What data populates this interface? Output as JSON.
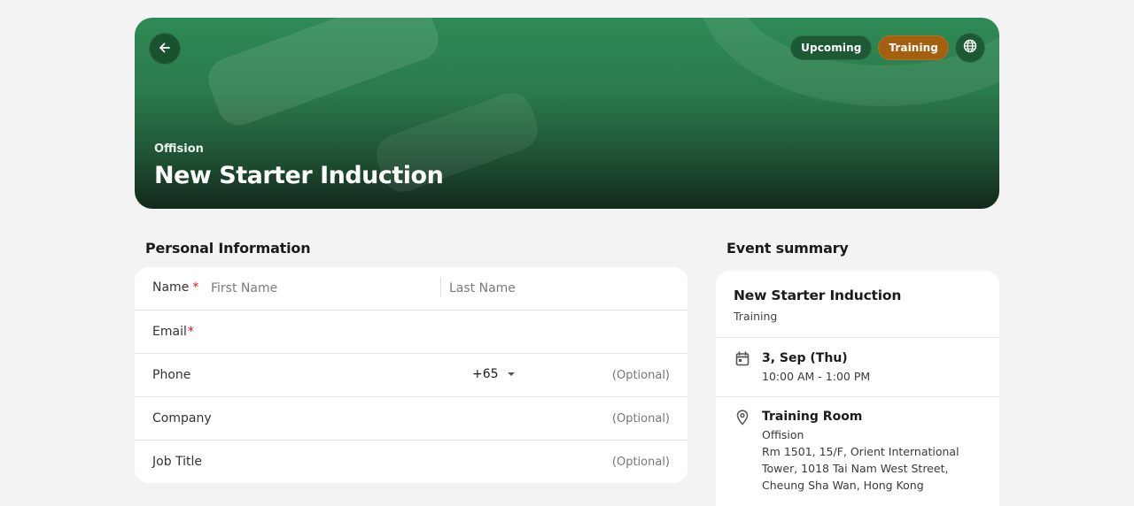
{
  "hero": {
    "organizer": "Offision",
    "title": "New Starter Induction",
    "badges": {
      "status": "Upcoming",
      "category": "Training"
    },
    "icons": {
      "back": "arrow-left-icon",
      "language": "globe-icon"
    },
    "colors": {
      "primary_green": "#2e8b55",
      "status_badge": "#1b5a34",
      "category_badge": "#a5600f"
    }
  },
  "personal_info": {
    "title": "Personal Information",
    "name": {
      "label": "Name",
      "required_mark": "*",
      "first_placeholder": "First Name",
      "last_placeholder": "Last Name"
    },
    "email": {
      "label": "Email",
      "required_mark": "*"
    },
    "phone": {
      "label": "Phone",
      "country_code": "+65",
      "optional": "(Optional)"
    },
    "company": {
      "label": "Company",
      "optional": "(Optional)"
    },
    "job_title": {
      "label": "Job Title",
      "optional": "(Optional)"
    }
  },
  "event_summary": {
    "title": "Event summary",
    "event_name": "New Starter Induction",
    "event_type": "Training",
    "date": "3, Sep (Thu)",
    "time": "10:00 AM - 1:00 PM",
    "venue": "Training Room",
    "venue_org": "Offision",
    "address_lines": [
      "Rm 1501, 15/F, Orient International",
      "Tower, 1018 Tai Nam West Street,",
      "Cheung Sha Wan, Hong Kong"
    ],
    "icons": {
      "date": "calendar-icon",
      "location": "location-pin-icon"
    }
  }
}
